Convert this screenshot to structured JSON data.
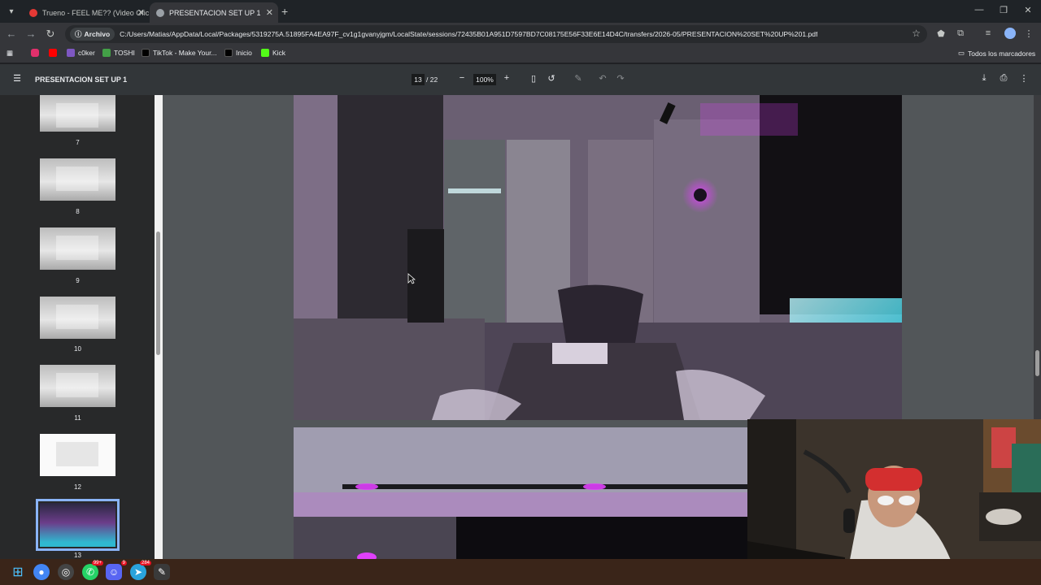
{
  "browser": {
    "tabs": [
      {
        "title": "Trueno - FEEL ME?? (Video Ofic",
        "favicon_color": "#e53935",
        "active": false
      },
      {
        "title": "PRESENTACION SET UP 1",
        "favicon_color": "#9aa0a6",
        "active": true
      }
    ],
    "address": {
      "chip_label": "Archivo",
      "url": "C:/Users/Matias/AppData/Local/Packages/5319275A.51895FA4EA97F_cv1g1gvanyjgm/LocalState/sessions/72435B01A951D7597BD7C08175E56F33E6E14D4C/transfers/2026-05/PRESENTACION%20SET%20UP%201.pdf"
    },
    "bookmarks": [
      {
        "label": "",
        "icon": "instagram-icon",
        "color": "#e1306c"
      },
      {
        "label": "",
        "icon": "youtube-icon",
        "color": "#ff0000"
      },
      {
        "label": "c0ker",
        "icon": "c0ker-icon",
        "color": "#7e57c2"
      },
      {
        "label": "TOSHI",
        "icon": "toshi-icon",
        "color": "#43a047"
      },
      {
        "label": "TikTok - Make Your...",
        "icon": "tiktok-icon",
        "color": "#000000"
      },
      {
        "label": "Inicio",
        "icon": "x-icon",
        "color": "#000000"
      },
      {
        "label": "Kick",
        "icon": "kick-icon",
        "color": "#53fc18"
      }
    ],
    "all_bookmarks_label": "Todos los marcadores"
  },
  "pdf": {
    "title": "PRESENTACION SET UP 1",
    "current_page": "13",
    "total_pages": "/ 22",
    "zoom": "100%",
    "thumbnails": [
      {
        "label": "7",
        "selected": false
      },
      {
        "label": "8",
        "selected": false
      },
      {
        "label": "9",
        "selected": false
      },
      {
        "label": "10",
        "selected": false
      },
      {
        "label": "11",
        "selected": false
      },
      {
        "label": "12",
        "selected": false
      },
      {
        "label": "13",
        "selected": true
      }
    ]
  },
  "taskbar": {
    "apps": [
      {
        "icon": "windows-start-icon",
        "color": "#4cc2ff"
      },
      {
        "icon": "chrome-icon",
        "color": "#4285f4"
      },
      {
        "icon": "obs-icon",
        "color": "#444444"
      },
      {
        "icon": "whatsapp-icon",
        "color": "#25d366",
        "badge": "99+"
      },
      {
        "icon": "discord-icon",
        "color": "#5865f2",
        "badge": "9"
      },
      {
        "icon": "telegram-icon",
        "color": "#2aa3dc",
        "badge": "284"
      },
      {
        "icon": "tool-icon",
        "color": "#8bc34a"
      }
    ]
  },
  "colors": {
    "accent": "#8ab4f8",
    "neon_magenta": "#e040fb",
    "neon_cyan": "#4dd0e1"
  }
}
